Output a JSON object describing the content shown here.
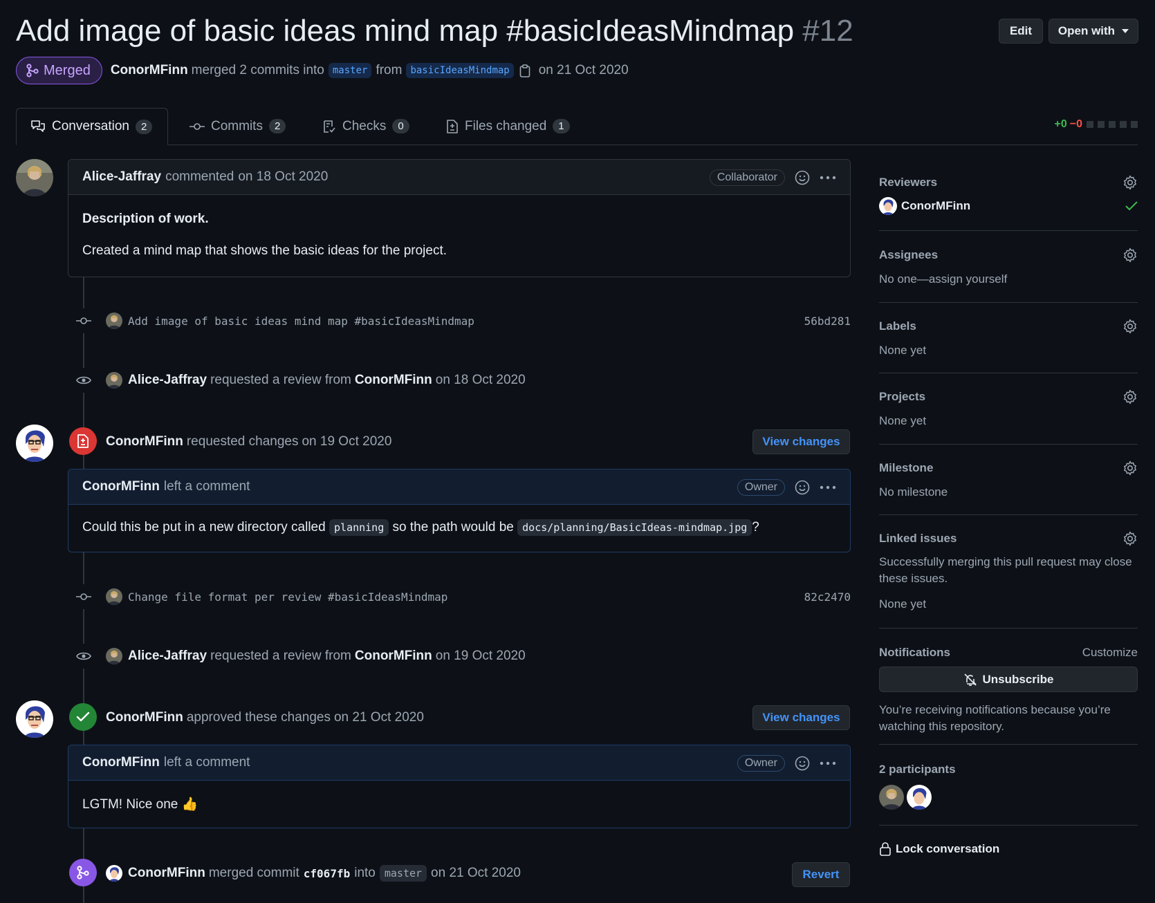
{
  "header": {
    "title": "Add image of basic ideas mind map #basicIdeasMindmap",
    "number": "#12",
    "edit_label": "Edit",
    "open_with_label": "Open with",
    "status_label": "Merged",
    "author": "ConorMFinn",
    "merged_text": "merged 2 commits into",
    "base_branch": "master",
    "from_text": "from",
    "head_branch": "basicIdeasMindmap",
    "date_text": "on 21 Oct 2020"
  },
  "tabs": [
    {
      "label": "Conversation",
      "count": "2"
    },
    {
      "label": "Commits",
      "count": "2"
    },
    {
      "label": "Checks",
      "count": "0"
    },
    {
      "label": "Files changed",
      "count": "1"
    }
  ],
  "diffstat": {
    "additions": "+0",
    "deletions": "−0"
  },
  "timeline": {
    "first_comment": {
      "author": "Alice-Jaffray",
      "action": "commented",
      "date": "on 18 Oct 2020",
      "role": "Collaborator",
      "heading": "Description of work.",
      "body": "Created a mind map that shows the basic ideas for the project."
    },
    "commit1": {
      "message": "Add image of basic ideas mind map #basicIdeasMindmap",
      "sha": "56bd281"
    },
    "review_request1": {
      "actor": "Alice-Jaffray",
      "text": "requested a review from",
      "target": "ConorMFinn",
      "date": "on 18 Oct 2020"
    },
    "review1": {
      "author": "ConorMFinn",
      "action": "requested changes",
      "date": "on 19 Oct 2020",
      "button": "View changes",
      "comment_author": "ConorMFinn",
      "comment_action": "left a comment",
      "role": "Owner",
      "body_pre": "Could this be put in a new directory called",
      "code1": "planning",
      "body_mid": "so the path would be",
      "code2": "docs/planning/BasicIdeas-mindmap.jpg",
      "body_post": "?"
    },
    "commit2": {
      "message": "Change file format per review #basicIdeasMindmap",
      "sha": "82c2470"
    },
    "review_request2": {
      "actor": "Alice-Jaffray",
      "text": "requested a review from",
      "target": "ConorMFinn",
      "date": "on 19 Oct 2020"
    },
    "review2": {
      "author": "ConorMFinn",
      "action": "approved these changes",
      "date": "on 21 Oct 2020",
      "button": "View changes",
      "comment_author": "ConorMFinn",
      "comment_action": "left a comment",
      "role": "Owner",
      "body": "LGTM! Nice one 👍"
    },
    "merge": {
      "actor": "ConorMFinn",
      "text": "merged commit",
      "sha": "cf067fb",
      "into": "into",
      "branch": "master",
      "date": "on 21 Oct 2020",
      "button": "Revert"
    }
  },
  "sidebar": {
    "reviewers": {
      "title": "Reviewers",
      "name": "ConorMFinn"
    },
    "assignees": {
      "title": "Assignees",
      "value": "No one—assign yourself"
    },
    "labels": {
      "title": "Labels",
      "value": "None yet"
    },
    "projects": {
      "title": "Projects",
      "value": "None yet"
    },
    "milestone": {
      "title": "Milestone",
      "value": "No milestone"
    },
    "linked_issues": {
      "title": "Linked issues",
      "description": "Successfully merging this pull request may close these issues.",
      "value": "None yet"
    },
    "notifications": {
      "title": "Notifications",
      "customize": "Customize",
      "button": "Unsubscribe",
      "description": "You’re receiving notifications because you’re watching this repository."
    },
    "participants": {
      "title": "2 participants"
    },
    "lock": {
      "label": "Lock conversation"
    }
  },
  "colors": {
    "merged": "#8957e5",
    "changes_requested": "#da3633",
    "approved": "#238636",
    "link": "#4493f8"
  }
}
